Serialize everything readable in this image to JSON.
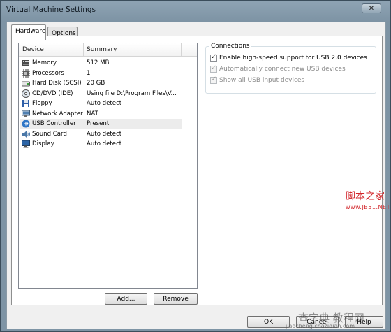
{
  "window": {
    "title": "Virtual Machine Settings",
    "close_glyph": "✕"
  },
  "tabs": [
    {
      "label": "Hardware",
      "active": true
    },
    {
      "label": "Options",
      "active": false
    }
  ],
  "device_list": {
    "columns": [
      "Device",
      "Summary"
    ],
    "rows": [
      {
        "device": "Memory",
        "summary": "512 MB",
        "icon": "memory-icon"
      },
      {
        "device": "Processors",
        "summary": "1",
        "icon": "processor-icon"
      },
      {
        "device": "Hard Disk (SCSI)",
        "summary": "20 GB",
        "icon": "hard-disk-icon"
      },
      {
        "device": "CD/DVD (IDE)",
        "summary": "Using file D:\\Program Files\\V...",
        "icon": "cd-dvd-icon"
      },
      {
        "device": "Floppy",
        "summary": "Auto detect",
        "icon": "floppy-icon"
      },
      {
        "device": "Network Adapter",
        "summary": "NAT",
        "icon": "network-adapter-icon"
      },
      {
        "device": "USB Controller",
        "summary": "Present",
        "icon": "usb-controller-icon",
        "selected": true
      },
      {
        "device": "Sound Card",
        "summary": "Auto detect",
        "icon": "sound-card-icon"
      },
      {
        "device": "Display",
        "summary": "Auto detect",
        "icon": "display-icon"
      }
    ]
  },
  "list_buttons": {
    "add": "Add...",
    "remove": "Remove"
  },
  "connections": {
    "title": "Connections",
    "options": [
      {
        "label": "Enable high-speed support for USB 2.0 devices",
        "checked": true,
        "enabled": true
      },
      {
        "label": "Automatically connect new USB devices",
        "checked": true,
        "enabled": false
      },
      {
        "label": "Show all USB input devices",
        "checked": true,
        "enabled": false
      }
    ]
  },
  "dialog_buttons": {
    "ok": "OK",
    "cancel": "Cancel",
    "help": "Help"
  },
  "watermarks": {
    "brand_cn": "脚本之家",
    "brand_url": "www.JB51.NET",
    "site_cn": "查字典 教程网",
    "site_url": "jiaocheng.chazidian.com"
  },
  "check_glyph": "✓",
  "colors": {
    "watermark_red": "#d2262b",
    "selection": "#ececec",
    "title_bar": "#8fa4b4"
  }
}
